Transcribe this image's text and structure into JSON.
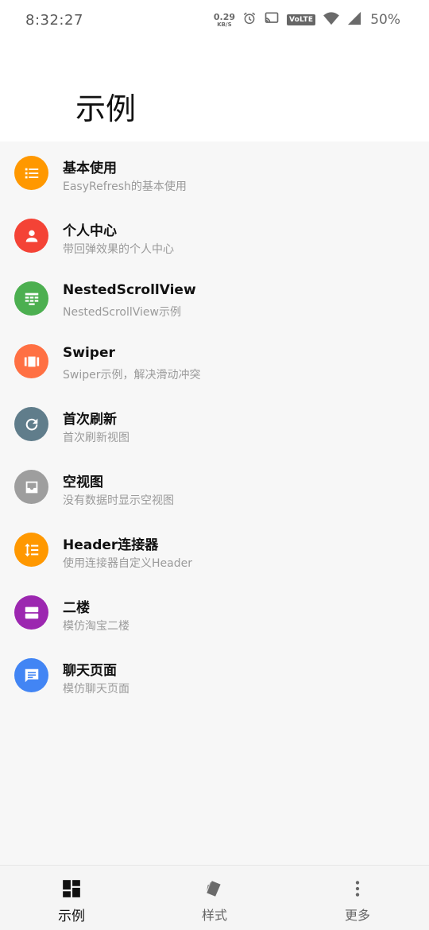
{
  "status_bar": {
    "time": "8:32:27",
    "net_speed_value": "0.29",
    "net_speed_unit": "KB/S",
    "volte": "VoLTE",
    "battery": "50%"
  },
  "app_bar": {
    "title": "示例"
  },
  "items": [
    {
      "title": "基本使用",
      "subtitle": "EasyRefresh的基本使用",
      "color": "#FF9800",
      "icon": "list-icon"
    },
    {
      "title": "个人中心",
      "subtitle": "带回弹效果的个人中心",
      "color": "#F44336",
      "icon": "person-icon"
    },
    {
      "title": "NestedScrollView",
      "subtitle": "NestedScrollView示例",
      "color": "#4CAF50",
      "icon": "table-icon"
    },
    {
      "title": "Swiper",
      "subtitle": "Swiper示例，解决滑动冲突",
      "color": "#FF7043",
      "icon": "carousel-icon"
    },
    {
      "title": "首次刷新",
      "subtitle": "首次刷新视图",
      "color": "#607D8B",
      "icon": "refresh-icon"
    },
    {
      "title": "空视图",
      "subtitle": "没有数据时显示空视图",
      "color": "#9E9E9E",
      "icon": "inbox-icon"
    },
    {
      "title": "Header连接器",
      "subtitle": "使用连接器自定义Header",
      "color": "#FF9800",
      "icon": "sort-icon"
    },
    {
      "title": "二楼",
      "subtitle": "模仿淘宝二楼",
      "color": "#9C27B0",
      "icon": "view-agenda-icon"
    },
    {
      "title": "聊天页面",
      "subtitle": "模仿聊天页面",
      "color": "#4285F4",
      "icon": "chat-icon"
    }
  ],
  "bottom_nav": {
    "tabs": [
      {
        "label": "示例",
        "icon": "dashboard-icon",
        "active": true
      },
      {
        "label": "样式",
        "icon": "style-icon",
        "active": false
      },
      {
        "label": "更多",
        "icon": "more-vert-icon",
        "active": false
      }
    ]
  }
}
